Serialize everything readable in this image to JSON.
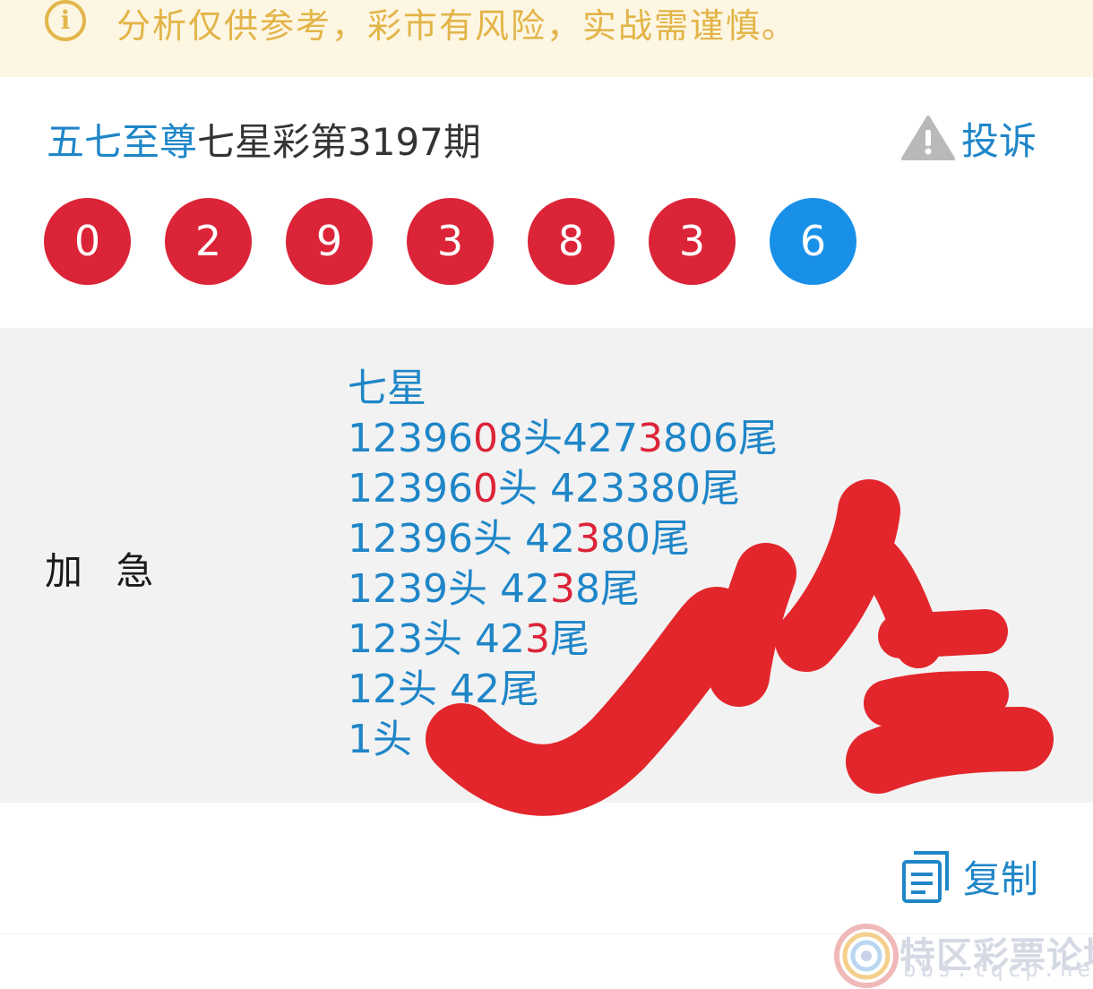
{
  "notice": {
    "icon": "info-icon",
    "text": "分析仅供参考，彩市有风险，实战需谨慎。"
  },
  "title": {
    "author": "五七至尊",
    "issue": "七星彩第3197期"
  },
  "complain": {
    "icon": "warning-icon",
    "label": "投诉"
  },
  "balls": [
    {
      "value": "0",
      "color": "#dc2438"
    },
    {
      "value": "2",
      "color": "#dc2438"
    },
    {
      "value": "9",
      "color": "#dc2438"
    },
    {
      "value": "3",
      "color": "#dc2438"
    },
    {
      "value": "8",
      "color": "#dc2438"
    },
    {
      "value": "3",
      "color": "#dc2438"
    },
    {
      "value": "6",
      "color": "#1890e8"
    }
  ],
  "post": {
    "label": "加 急",
    "heading": "七星",
    "lines": [
      [
        {
          "t": "12396",
          "hl": false
        },
        {
          "t": "0",
          "hl": true
        },
        {
          "t": "8头427",
          "hl": false
        },
        {
          "t": "3",
          "hl": true
        },
        {
          "t": "806尾",
          "hl": false
        }
      ],
      [
        {
          "t": "12396",
          "hl": false
        },
        {
          "t": "0",
          "hl": true
        },
        {
          "t": "头 423",
          "hl": false
        },
        {
          "t": "3",
          "hl": false
        },
        {
          "t": "80尾",
          "hl": false
        }
      ],
      [
        {
          "t": "12396头 42",
          "hl": false
        },
        {
          "t": "3",
          "hl": true
        },
        {
          "t": "80尾",
          "hl": false
        }
      ],
      [
        {
          "t": "1239头 42",
          "hl": false
        },
        {
          "t": "3",
          "hl": true
        },
        {
          "t": "8尾",
          "hl": false
        }
      ],
      [
        {
          "t": "123头 42",
          "hl": false
        },
        {
          "t": "3",
          "hl": true
        },
        {
          "t": "尾",
          "hl": false
        }
      ],
      [
        {
          "t": "12头 42尾",
          "hl": false
        }
      ],
      [
        {
          "t": "1头 4尾",
          "hl": false
        }
      ]
    ],
    "highlight_color": "#dc2438",
    "text_color": "#1f86c8"
  },
  "stamp": {
    "text": "准",
    "color": "#e3262b"
  },
  "copy": {
    "icon": "copy-icon",
    "label": "复制"
  },
  "watermark": {
    "logo": "forum-logo-icon",
    "text": "特区彩票论坛",
    "url": "bbs.tqcp.net"
  }
}
